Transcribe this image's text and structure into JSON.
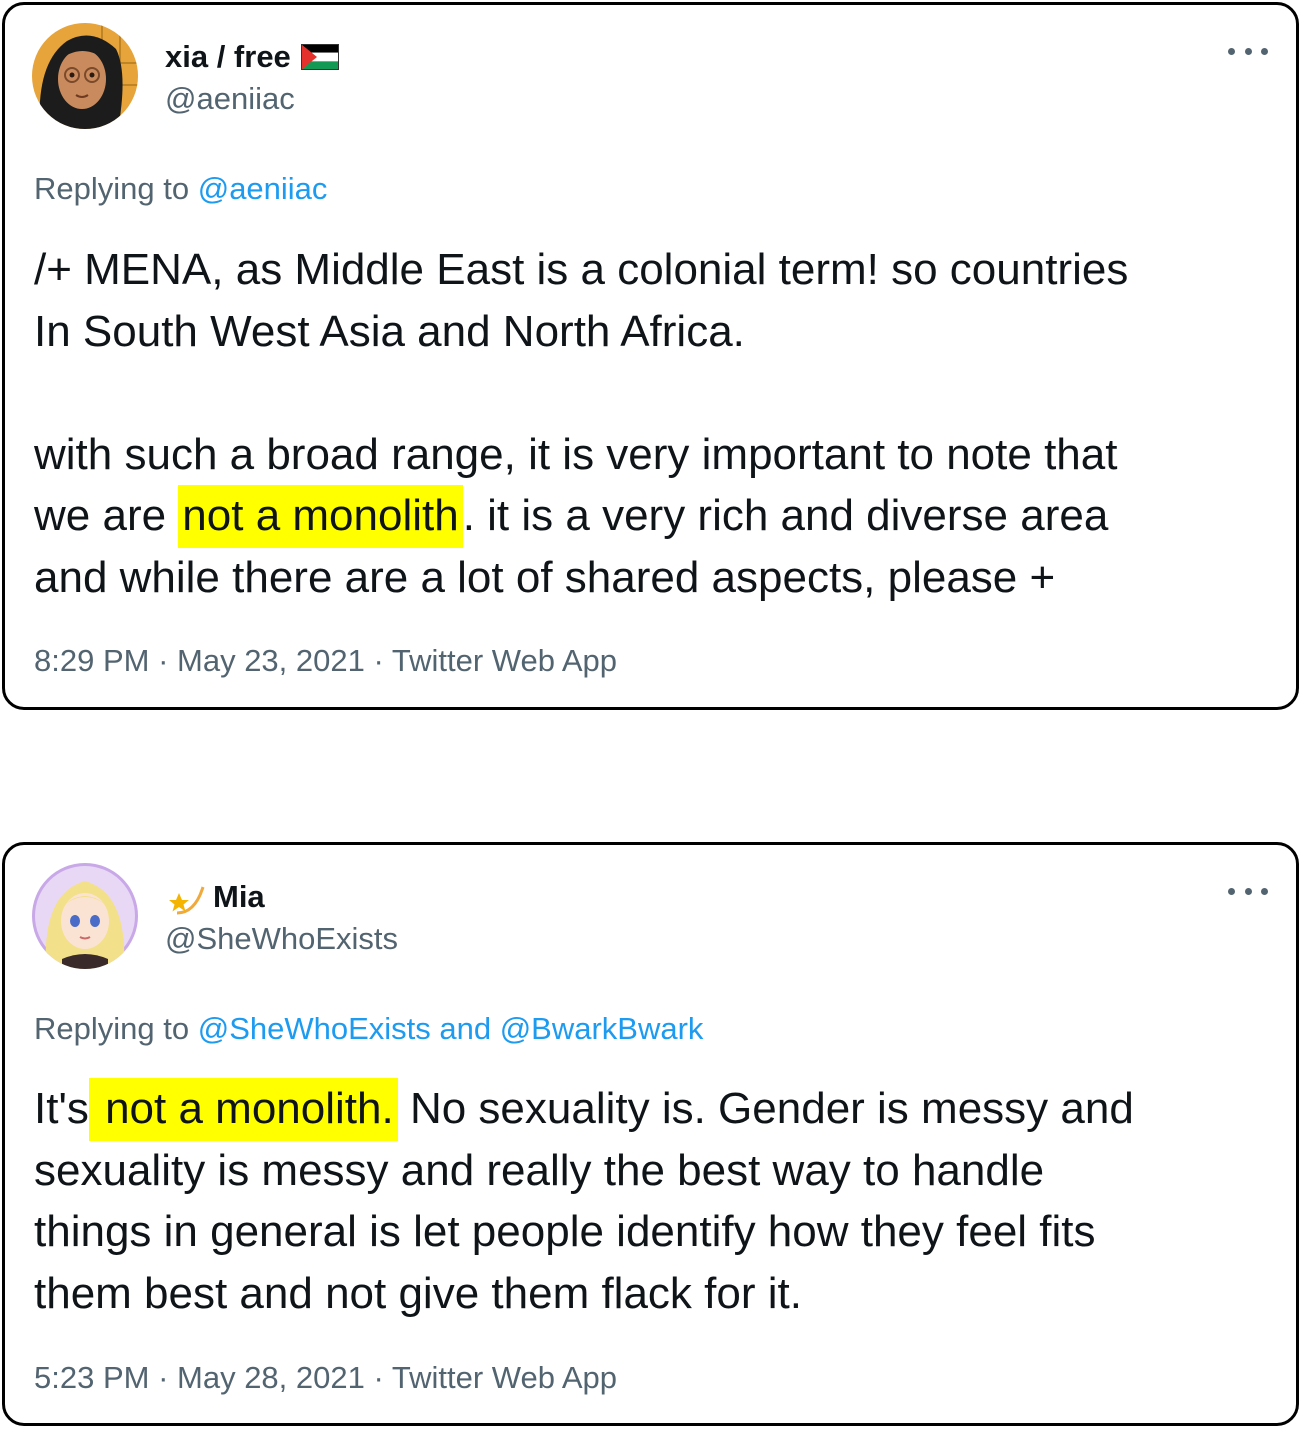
{
  "tweets": [
    {
      "name": "xia / free",
      "handle": "@aeniiac",
      "replying_prefix": "Replying to ",
      "replying_to": "@aeniiac",
      "body": {
        "p1_l1": "/+ MENA, as Middle East is a colonial term! so countries",
        "p1_l2": "In South West Asia and North Africa.",
        "p2_l1": "with such a broad range, it is very important to note that",
        "p2_l2_a": "we are ",
        "p2_l2_hl": "not a monolith",
        "p2_l2_b": ". it is a very rich and diverse area",
        "p2_l3": "and while there are a lot of shared aspects, please +"
      },
      "time": "8:29 PM",
      "sep": " · ",
      "date": "May 23, 2021",
      "client": "Twitter Web App"
    },
    {
      "name": "Mia",
      "handle": "@SheWhoExists",
      "replying_prefix": "Replying to ",
      "replying_to": "@SheWhoExists and @BwarkBwark",
      "body": {
        "l1_a": "It's",
        "l1_hl": " not a monolith.",
        "l1_b": " No sexuality is. Gender is messy and",
        "l2": "sexuality is messy and really the best way to handle",
        "l3": "things in general is let people identify how they feel fits",
        "l4": "them best and not give them flack for it."
      },
      "time": "5:23 PM",
      "sep": " · ",
      "date": "May 28, 2021",
      "client": "Twitter Web App"
    }
  ],
  "icons": [
    "palestine-flag-icon",
    "shooting-star-icon",
    "more-icon"
  ],
  "colors": {
    "highlight": "#ffff00",
    "link": "#1d9bf0",
    "muted": "#536471",
    "text": "#0f1419"
  }
}
